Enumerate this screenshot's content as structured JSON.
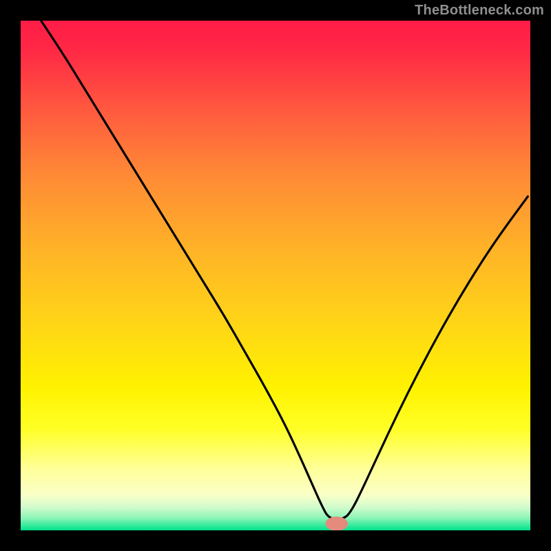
{
  "watermark": "TheBottleneck.com",
  "chart_data": {
    "type": "line",
    "title": "",
    "xlabel": "",
    "ylabel": "",
    "xlim": [
      0,
      100
    ],
    "ylim": [
      0,
      100
    ],
    "grid": false,
    "legend": false,
    "background_gradient": {
      "stops": [
        {
          "offset": 0.0,
          "color": "#ff1c47"
        },
        {
          "offset": 0.06,
          "color": "#ff2945"
        },
        {
          "offset": 0.17,
          "color": "#ff573f"
        },
        {
          "offset": 0.3,
          "color": "#ff8936"
        },
        {
          "offset": 0.45,
          "color": "#ffb327"
        },
        {
          "offset": 0.6,
          "color": "#ffd716"
        },
        {
          "offset": 0.72,
          "color": "#fff200"
        },
        {
          "offset": 0.8,
          "color": "#ffff25"
        },
        {
          "offset": 0.88,
          "color": "#ffff9a"
        },
        {
          "offset": 0.93,
          "color": "#faffc7"
        },
        {
          "offset": 0.955,
          "color": "#d0fccc"
        },
        {
          "offset": 0.975,
          "color": "#90f5b8"
        },
        {
          "offset": 0.99,
          "color": "#38eb9d"
        },
        {
          "offset": 1.0,
          "color": "#00e08c"
        }
      ]
    },
    "series": [
      {
        "name": "bottleneck-curve",
        "color": "#000000",
        "x": [
          4,
          8,
          12,
          16,
          20,
          24,
          28,
          32,
          36,
          40,
          44,
          48,
          52,
          55,
          57,
          59,
          60.5,
          63.5,
          65,
          67,
          70,
          74,
          78,
          82,
          86,
          90,
          94,
          99.5
        ],
        "y": [
          100,
          94,
          87.5,
          81,
          74.5,
          68,
          61.5,
          55,
          48.5,
          42,
          35,
          28,
          20.5,
          14,
          9.5,
          5,
          2.2,
          2.2,
          4,
          8,
          14.5,
          23,
          31,
          38.5,
          45.5,
          52,
          58,
          65.5
        ]
      }
    ],
    "marker": {
      "name": "optimal-point-marker",
      "x": 62.0,
      "y": 1.3,
      "rx": 2.2,
      "ry": 1.4,
      "color": "#e48b7e"
    }
  }
}
